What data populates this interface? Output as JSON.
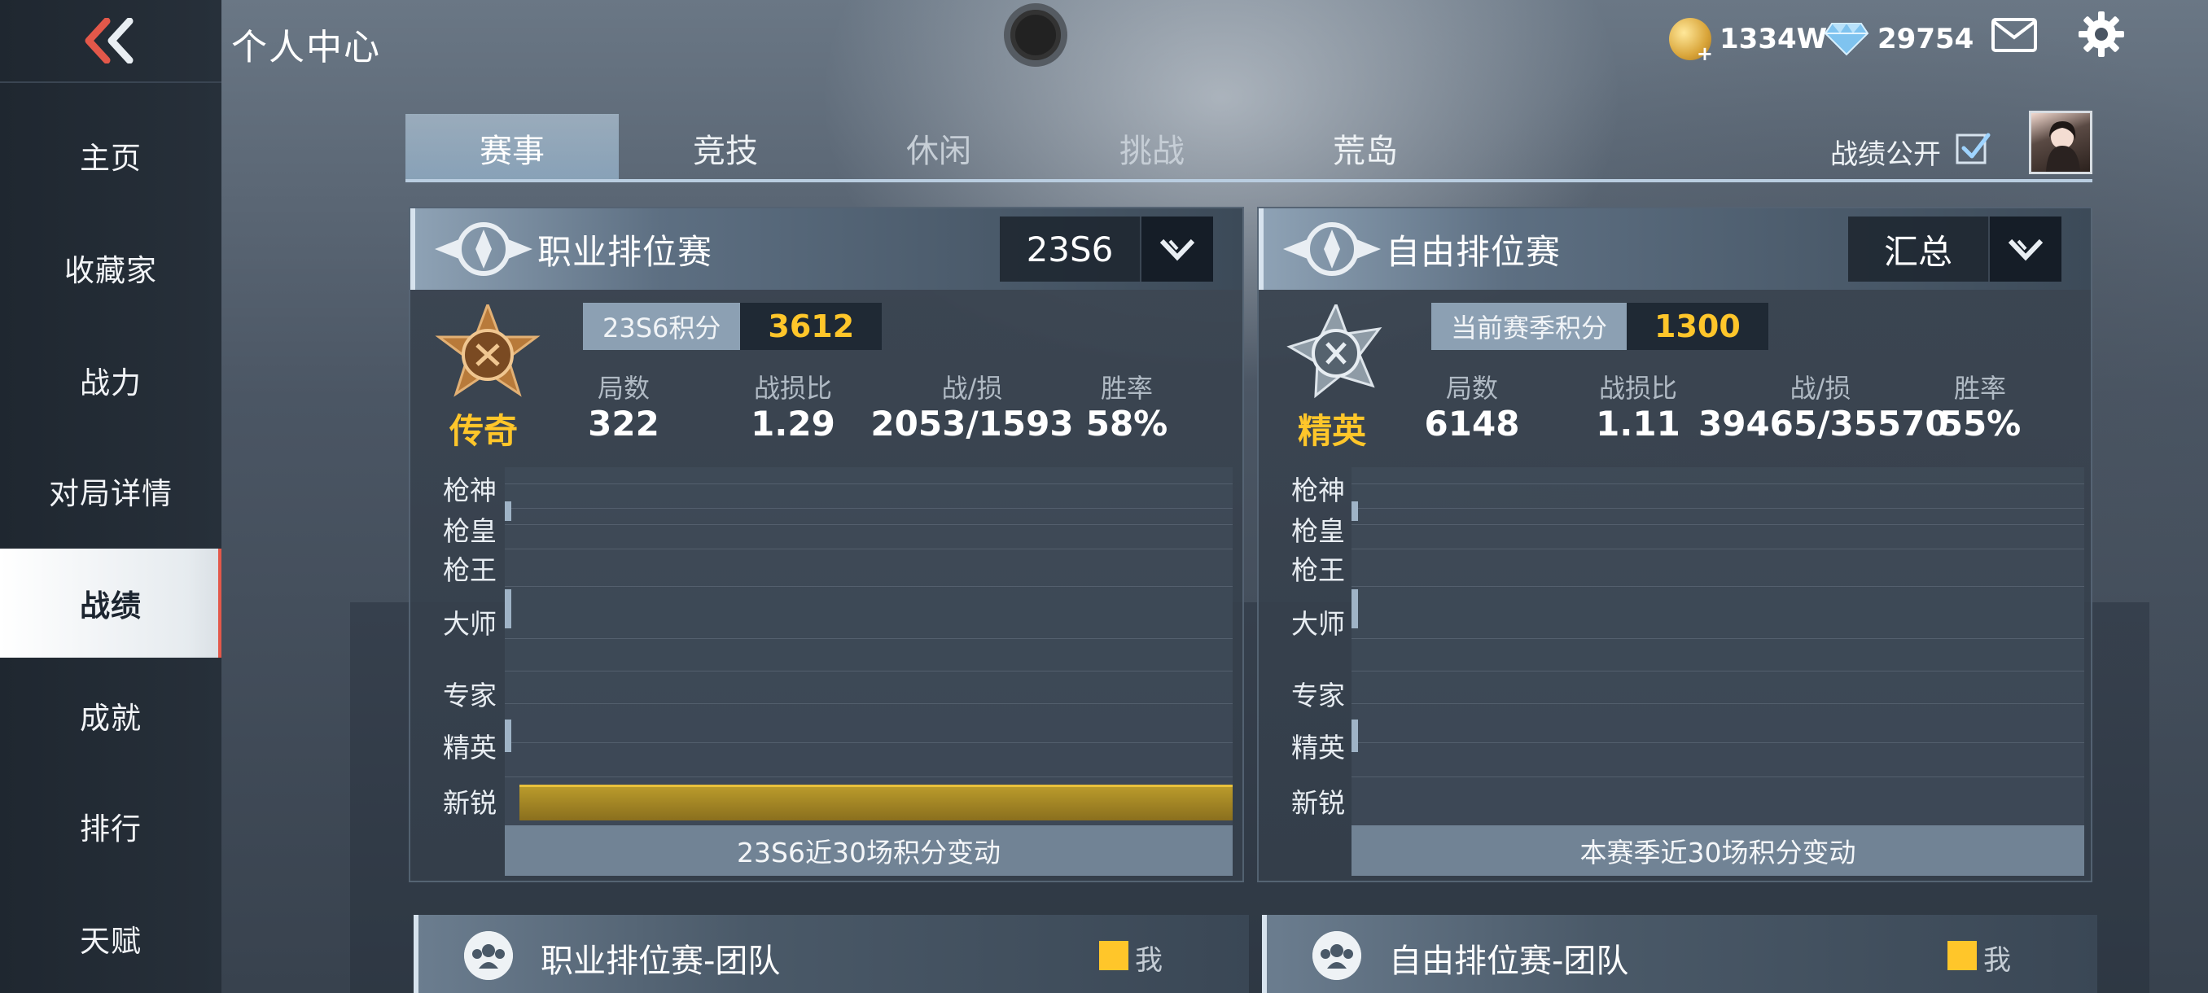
{
  "header": {
    "title": "个人中心",
    "gold": "1334W",
    "diamonds": "29754"
  },
  "sidebar": {
    "items": [
      {
        "label": "主页"
      },
      {
        "label": "收藏家"
      },
      {
        "label": "战力"
      },
      {
        "label": "对局详情"
      },
      {
        "label": "战绩",
        "active": true
      },
      {
        "label": "成就"
      },
      {
        "label": "排行"
      },
      {
        "label": "天赋"
      }
    ]
  },
  "tabs": [
    {
      "label": "赛事",
      "active": true
    },
    {
      "label": "竞技"
    },
    {
      "label": "休闲"
    },
    {
      "label": "挑战"
    },
    {
      "label": "荒岛"
    }
  ],
  "public_record": {
    "label": "战绩公开",
    "checked": true
  },
  "rank_labels": [
    "枪神",
    "枪皇",
    "枪王",
    "大师",
    "专家",
    "精英",
    "新锐"
  ],
  "panels": [
    {
      "title": "职业排位赛",
      "dropdown": "23S6",
      "rank": "传奇",
      "score_label": "23S6积分",
      "score": "3612",
      "stats": [
        {
          "label": "局数",
          "value": "322"
        },
        {
          "label": "战损比",
          "value": "1.29"
        },
        {
          "label": "战/损",
          "value": "2053/1593"
        },
        {
          "label": "胜率",
          "value": "58%"
        }
      ],
      "caption": "23S6近30场积分变动"
    },
    {
      "title": "自由排位赛",
      "dropdown": "汇总",
      "rank": "精英",
      "score_label": "当前赛季积分",
      "score": "1300",
      "stats": [
        {
          "label": "局数",
          "value": "6148"
        },
        {
          "label": "战损比",
          "value": "1.11"
        },
        {
          "label": "战/损",
          "value": "39465/35570"
        },
        {
          "label": "胜率",
          "value": "55%"
        }
      ],
      "caption": "本赛季近30场积分变动"
    }
  ],
  "team_panels": [
    {
      "title": "职业排位赛-团队",
      "legend": "我"
    },
    {
      "title": "自由排位赛-团队",
      "legend": "我"
    }
  ],
  "colors": {
    "accent_gold": "#ffc62a",
    "active_marker": "#e3584a"
  }
}
